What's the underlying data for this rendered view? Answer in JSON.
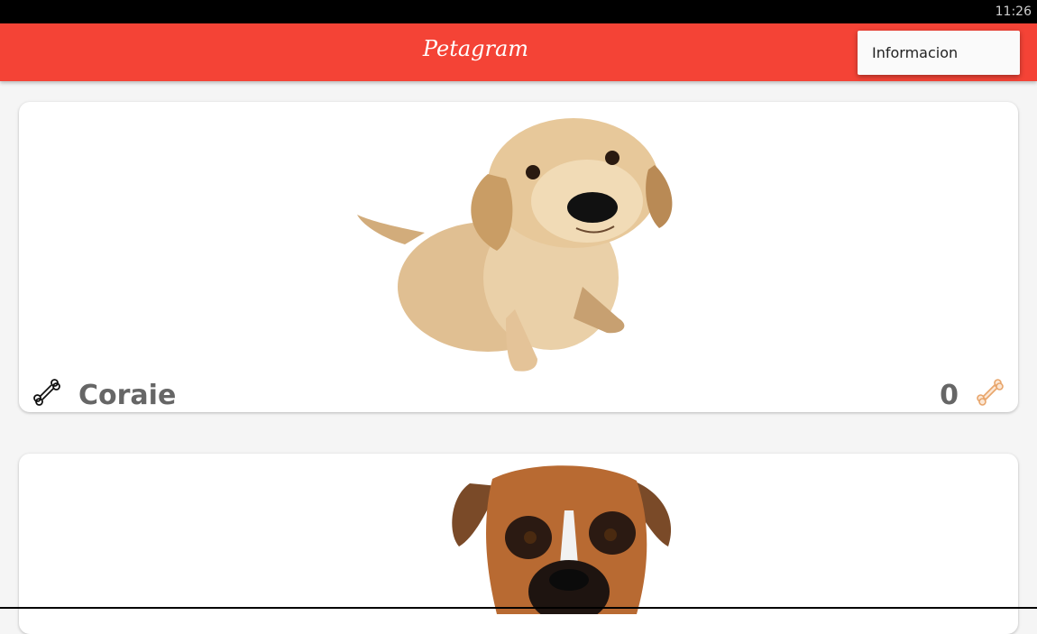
{
  "status_bar": {
    "time": "11:26"
  },
  "app_bar": {
    "title": "Petagram"
  },
  "overflow_menu": {
    "items": [
      {
        "label": "Informacion"
      }
    ]
  },
  "pets": [
    {
      "name": "Coraie",
      "likes": "0",
      "image_icon": "golden-puppy-photo"
    },
    {
      "image_icon": "boxer-dog-photo"
    }
  ],
  "colors": {
    "app_bar": "#f44336",
    "background": "#f5f5f5",
    "card": "#ffffff",
    "text_secondary": "#666666",
    "bone_like": "#e8a56b"
  },
  "icons": {
    "rate_button": "bone-outline-icon",
    "like_indicator": "bone-filled-icon"
  }
}
